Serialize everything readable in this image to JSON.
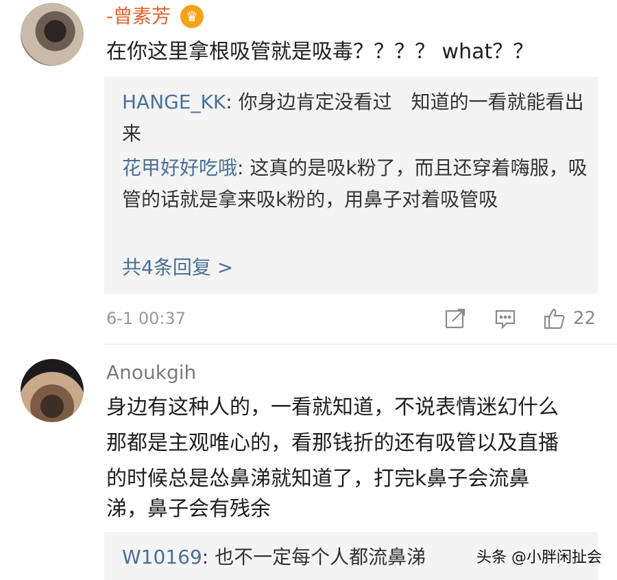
{
  "comments": [
    {
      "username": "-曾素芳",
      "body": "在你这里拿根吸管就是吸毒？？？？ what？？",
      "replies": [
        {
          "author": "HANGE_KK",
          "text": ": 你身边肯定没看过　知道的一看就能看出来"
        },
        {
          "author": "花甲好好吃哦",
          "text": ": 这真的是吸k粉了，而且还穿着嗨服，吸管的话就是拿来吸k粉的，用鼻子对着吸管吸"
        }
      ],
      "more_replies": "共4条回复 >",
      "time": "6-1 00:37",
      "likes": "22"
    },
    {
      "username": "Anoukgih",
      "body_lines": [
        "身边有这种人的，一看就知道，不说表情迷幻什么",
        "那都是主观唯心的，看那钱折的还有吸管以及直播",
        "的时候总是怂鼻涕就知道了，打完k鼻子会流鼻",
        "涕，鼻子会有残余"
      ],
      "replies": [
        {
          "author": "W10169",
          "text": ": 也不一定每个人都流鼻涕"
        }
      ]
    }
  ],
  "watermark": "头条 @小胖闲扯会",
  "colors": {
    "vip_name": "#e0632f",
    "reply_author": "#4a6f96",
    "reply_bg": "#f4f4f4",
    "crown": "#f3a21b"
  },
  "icons": {
    "crown": "crown-icon",
    "repost": "repost-icon",
    "comment": "comment-icon",
    "like": "thumbs-up-icon"
  }
}
